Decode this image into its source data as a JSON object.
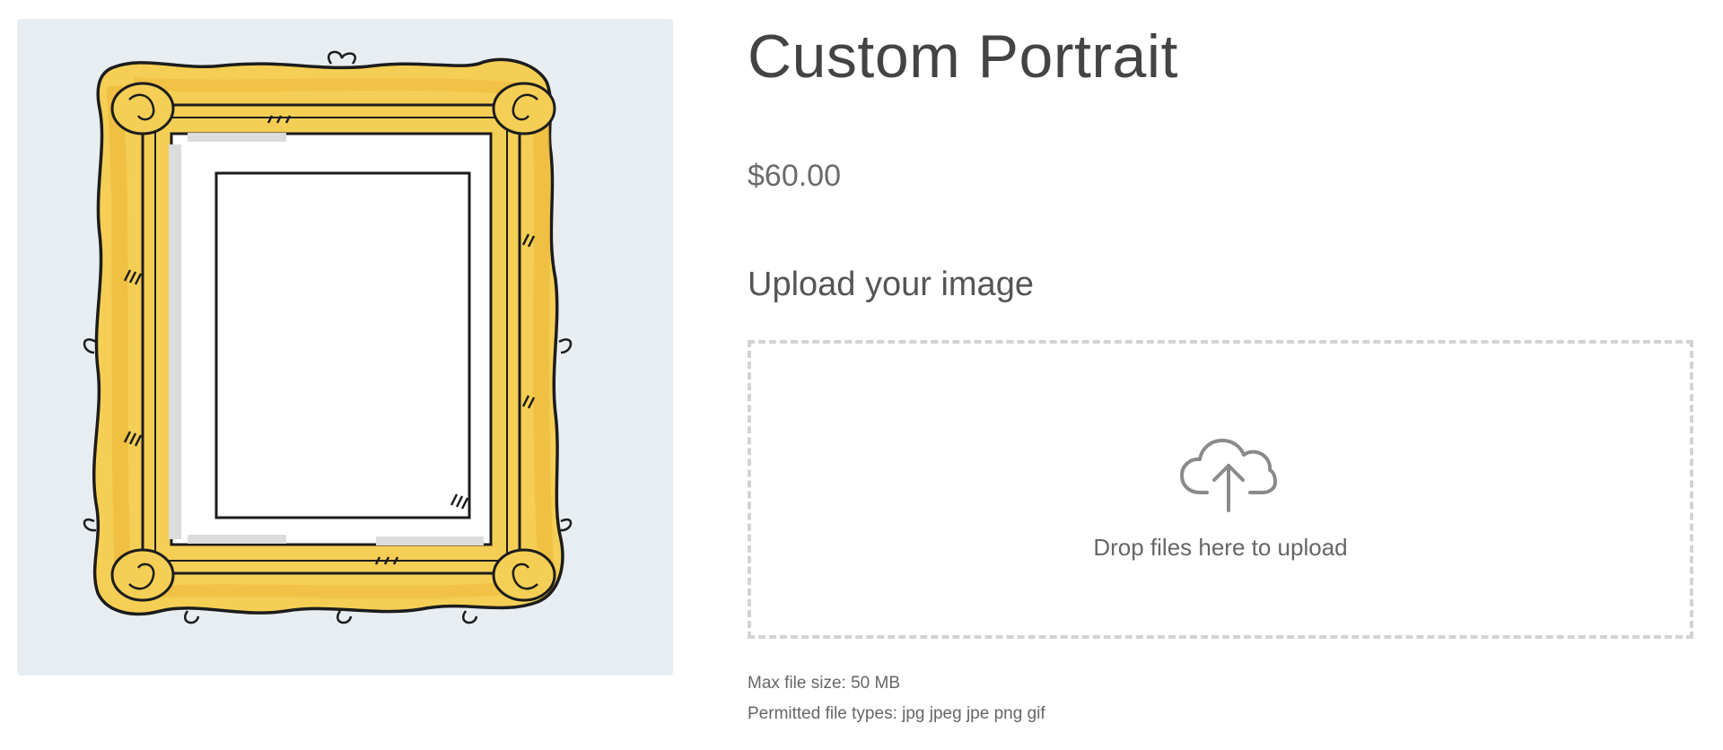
{
  "product": {
    "title": "Custom Portrait",
    "price": "$60.00",
    "image_description": "picture-frame-icon"
  },
  "upload": {
    "label": "Upload your image",
    "drop_text": "Drop files here to upload",
    "icon": "cloud-upload-icon",
    "max_file_size": "Max file size: 50 MB",
    "permitted_types": "Permitted file types: jpg jpeg jpe png gif"
  },
  "colors": {
    "frame_gold": "#f5cf55",
    "frame_gold_dark": "#eeb93a",
    "image_bg": "#e8edf1",
    "text": "#444444",
    "dropzone_border": "#d3d3d3"
  }
}
